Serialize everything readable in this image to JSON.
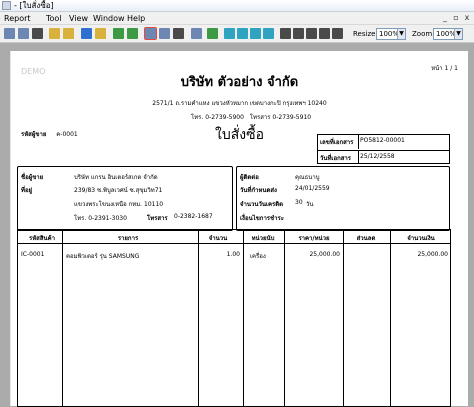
{
  "window": {
    "title": "- [ใบสั่งซื้อ]"
  },
  "menu": [
    "Report",
    "Tool",
    "View",
    "Window",
    "Help"
  ],
  "mdi_controls": [
    "_",
    "▫",
    "x"
  ],
  "toolbar": {
    "resize_label": "Resize:",
    "resize_value": "100%",
    "zoom_label": "Zoom:",
    "zoom_value": "100%"
  },
  "report": {
    "watermark": "DEMO",
    "page_no": "หน้า 1 / 1",
    "company_name": "บริษัท ตัวอย่าง จำกัด",
    "address": "2571/1 ถ.รามคำแหง แขวงหัวหมาก เขตบางกะปิ กรุงเทพฯ 10240",
    "tel": "โทร. 0-2739-5900",
    "fax": "โทรสาร 0-2739-5910",
    "doc_title": "ใบสั่งซื้อ",
    "doc_no_label": "เลขที่เอกสาร",
    "doc_no": "PO5812-00001",
    "doc_date_label": "วันที่เอกสาร",
    "doc_date": "25/12/2558",
    "supplier_code_label": "รหัสผู้ขาย",
    "supplier_code": "ค-0001",
    "supplier_name_label": "ชื่อผู้ขาย",
    "supplier_name": "บริษัท แกรน อินเตอร์สเกต จำกัด",
    "address_label": "ที่อยู่",
    "address_line1": "239/83 ซ.พิบูลเวศน์ ซ.สุขุมวิท71",
    "address_line2": "แขวงพระโขนงเหนือ กทม. 10110",
    "sup_tel": "โทร. 0-2391-3030",
    "sup_fax_label": "โทรสาร",
    "sup_fax": "0-2382-1687",
    "contact_label": "ผู้ติดต่อ",
    "contact": "คุณธนาบู",
    "due_label": "วันที่กำหนดส่ง",
    "due": "24/01/2559",
    "credit_label": "จำนวนวันเครดิต",
    "credit_days": "30",
    "credit_unit": "วัน",
    "payment_label": "เงื่อนไขการชำระ",
    "table_headers": [
      "รหัสสินค้า",
      "รายการ",
      "จำนวน",
      "หน่วยนับ",
      "ราคา/หน่วย",
      "ส่วนลด",
      "จำนวนเงิน"
    ],
    "rows": [
      {
        "code": "IC-0001",
        "desc": "คอมพิวเตอร์ รุ่น SAMSUNG",
        "qty": "1.00",
        "unit": "เครื่อง",
        "price": "25,000.00",
        "discount": "",
        "amount": "25,000.00"
      }
    ]
  }
}
